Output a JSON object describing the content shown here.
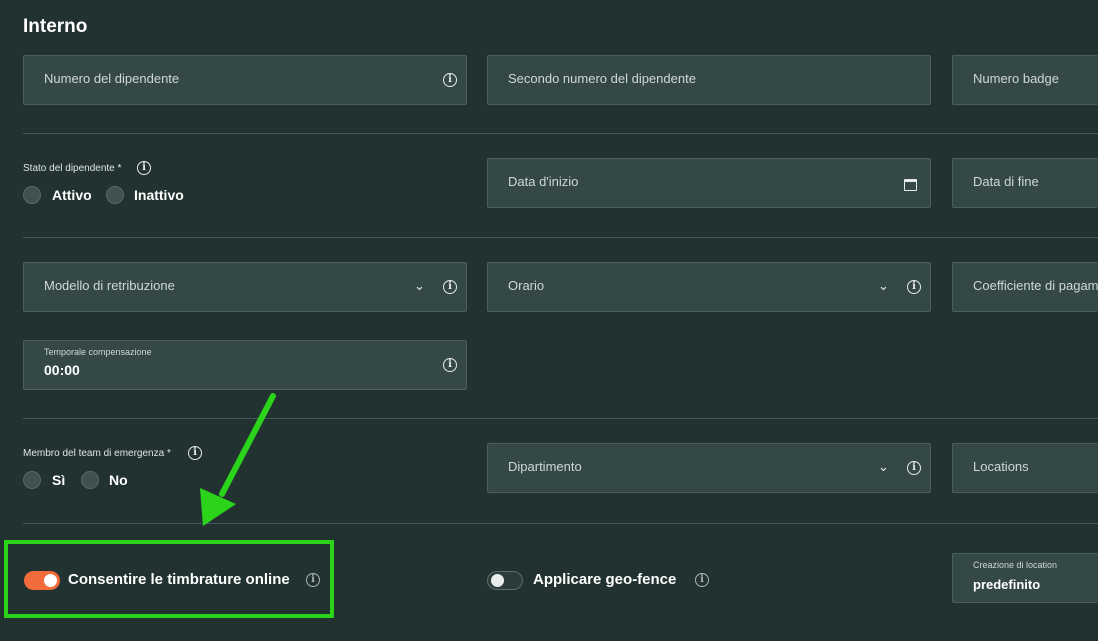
{
  "section_title": "Interno",
  "row1": {
    "employee_number": "Numero del dipendente",
    "second_employee_number": "Secondo numero del dipendente",
    "badge_number": "Numero badge"
  },
  "row2": {
    "status_label": "Stato del dipendente *",
    "status_options": [
      "Attivo",
      "Inattivo"
    ],
    "start_date": "Data d'inizio",
    "end_date": "Data di fine"
  },
  "row3": {
    "pay_model": "Modello di retribuzione",
    "schedule": "Orario",
    "payment_coefficient": "Coefficiente di pagame"
  },
  "row4": {
    "comp_label": "Temporale compensazione",
    "comp_value": "00:00"
  },
  "row5": {
    "emergency_label": "Membro del team di emergenza *",
    "emergency_options": [
      "Sì",
      "No"
    ],
    "department": "Dipartimento",
    "locations": "Locations"
  },
  "row6": {
    "allow_online_label": "Consentire le timbrature online",
    "allow_online_on": true,
    "geofence_label": "Applicare geo-fence",
    "geofence_on": false,
    "location_creation_label": "Creazione di location",
    "location_creation_value": "predefinito"
  },
  "colors": {
    "background": "#213230",
    "field": "#344845",
    "toggle_on": "#f26b3a",
    "annotation_green": "#2bd41a"
  },
  "icons": [
    "info-icon",
    "calendar-icon",
    "chevron-down-icon",
    "arrow-annotation"
  ]
}
